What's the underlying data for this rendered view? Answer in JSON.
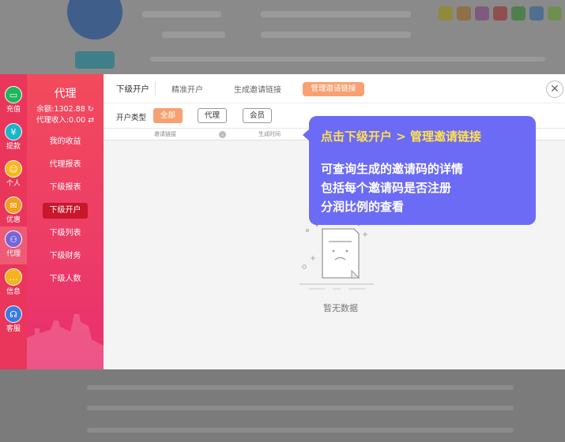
{
  "sidebar": {
    "icons": [
      {
        "name": "wallet-icon",
        "label": "充值",
        "glyph": "▭",
        "color": "#22b35e"
      },
      {
        "name": "withdraw-icon",
        "label": "提款",
        "glyph": "¥",
        "color": "#1cb5c6"
      },
      {
        "name": "person-icon",
        "label": "个人",
        "glyph": "☺",
        "color": "#f6b818"
      },
      {
        "name": "coupon-icon",
        "label": "优惠",
        "glyph": "✉",
        "color": "#f2a01d"
      },
      {
        "name": "agent-icon",
        "label": "代理",
        "glyph": "⚇",
        "color": "#7766d9"
      },
      {
        "name": "message-icon",
        "label": "信息",
        "glyph": "…",
        "color": "#f5b31d"
      },
      {
        "name": "service-icon",
        "label": "客服",
        "glyph": "☊",
        "color": "#3d7ae0"
      }
    ],
    "title": "代理",
    "balance": "余额:1302.88",
    "income": "代理收入:0.00",
    "menu": [
      "我的收益",
      "代理报表",
      "下级报表",
      "下级开户",
      "下级列表",
      "下级财务",
      "下级人数"
    ],
    "active_menu": "下级开户"
  },
  "tabs": {
    "first": "下级开户",
    "precise": "精准开户",
    "generate": "生成邀请链接",
    "manage": "管理邀请链接"
  },
  "filter": {
    "label": "开户类型",
    "options": [
      "全部",
      "代理",
      "会员"
    ],
    "selected": "全部"
  },
  "table": {
    "columns": [
      "邀请链接",
      "生成时间"
    ]
  },
  "empty_text": "暂无数据",
  "tooltip": {
    "title": "点击下级开户 > 管理邀请链接",
    "lines": [
      "可查询生成的邀请码的详情",
      "包括每个邀请码是否注册",
      "分润比例的查看"
    ]
  },
  "colors": {
    "accent_orange": "#f7a173",
    "sidebar_red": "#ec3c67",
    "tooltip_bg": "#6c6bf5",
    "tooltip_title": "#ffe14f"
  }
}
